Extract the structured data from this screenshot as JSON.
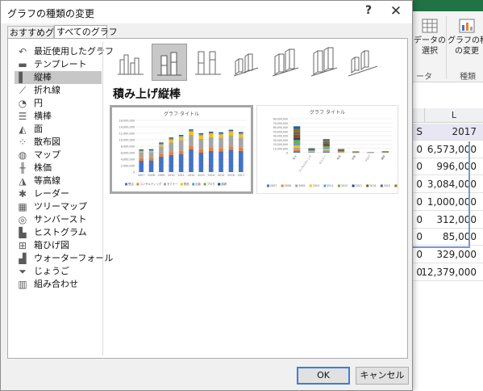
{
  "dialog": {
    "title": "グラフの種類の変更",
    "help": "?",
    "close": "✕"
  },
  "tabs": [
    {
      "label": "おすすめグラフ"
    },
    {
      "label": "すべてのグラフ"
    }
  ],
  "sidebar": {
    "items": [
      {
        "label": "最近使用したグラフ",
        "icon": "undo-icon",
        "glyph": "↶"
      },
      {
        "label": "テンプレート",
        "icon": "folder-icon",
        "glyph": "▬"
      },
      {
        "label": "縦棒",
        "icon": "column-chart-icon",
        "glyph": "▌"
      },
      {
        "label": "折れ線",
        "icon": "line-chart-icon",
        "glyph": "⟋"
      },
      {
        "label": "円",
        "icon": "pie-chart-icon",
        "glyph": "◔"
      },
      {
        "label": "横棒",
        "icon": "bar-chart-icon",
        "glyph": "☰"
      },
      {
        "label": "面",
        "icon": "area-chart-icon",
        "glyph": "◭"
      },
      {
        "label": "散布図",
        "icon": "scatter-chart-icon",
        "glyph": "⁘"
      },
      {
        "label": "マップ",
        "icon": "map-chart-icon",
        "glyph": "◍"
      },
      {
        "label": "株価",
        "icon": "stock-chart-icon",
        "glyph": "╫"
      },
      {
        "label": "等高線",
        "icon": "surface-chart-icon",
        "glyph": "◮"
      },
      {
        "label": "レーダー",
        "icon": "radar-chart-icon",
        "glyph": "✱"
      },
      {
        "label": "ツリーマップ",
        "icon": "treemap-chart-icon",
        "glyph": "▦"
      },
      {
        "label": "サンバースト",
        "icon": "sunburst-chart-icon",
        "glyph": "◎"
      },
      {
        "label": "ヒストグラム",
        "icon": "histogram-chart-icon",
        "glyph": "▙"
      },
      {
        "label": "箱ひげ図",
        "icon": "box-whisker-chart-icon",
        "glyph": "⊞"
      },
      {
        "label": "ウォーターフォール",
        "icon": "waterfall-chart-icon",
        "glyph": "▟"
      },
      {
        "label": "じょうご",
        "icon": "funnel-chart-icon",
        "glyph": "⏷"
      },
      {
        "label": "組み合わせ",
        "icon": "combo-chart-icon",
        "glyph": "▥"
      }
    ],
    "selected_index": 2
  },
  "chart_heading": "積み上げ縦棒",
  "previews": [
    {
      "title": "グラフ タイトル"
    },
    {
      "title": "グラフ タイトル"
    }
  ],
  "buttons": {
    "ok": "OK",
    "cancel": "キャンセル"
  },
  "excel": {
    "ribbon": {
      "data_select": "データの\n選択",
      "change_type": "グラフの種類\nの変更",
      "group_data": "ータ",
      "group_type": "種類"
    },
    "column_header": "L",
    "rows": [
      {
        "left": "S",
        "value": "2017"
      },
      {
        "left": "0",
        "value": "6,573,000"
      },
      {
        "left": "0",
        "value": "996,000"
      },
      {
        "left": "0",
        "value": "3,084,000"
      },
      {
        "left": "0",
        "value": "1,000,000"
      },
      {
        "left": "0",
        "value": "312,000"
      },
      {
        "left": "0",
        "value": "85,000"
      },
      {
        "left": "0",
        "value": "329,000"
      },
      {
        "left": "0",
        "value": "12,379,000"
      }
    ],
    "accent": "#217346"
  },
  "chart_data": [
    {
      "type": "bar",
      "stacked": true,
      "title": "グラフ タイトル",
      "categories": [
        "2007",
        "2008",
        "2009",
        "2010",
        "2011",
        "2012",
        "2013",
        "2014",
        "2015",
        "2016",
        "2017"
      ],
      "ylim": [
        0,
        16000000
      ],
      "yticks": [
        "0",
        "2,000,000",
        "4,000,000",
        "6,000,000",
        "8,000,000",
        "10,000,000",
        "12,000,000",
        "14,000,000",
        "16,000,000"
      ],
      "legend_position": "bottom",
      "series": [
        {
          "name": "受注",
          "color": "#4472c4",
          "values": [
            3500000,
            3600000,
            4800000,
            5300000,
            5600000,
            7000000,
            6000000,
            6500000,
            6400000,
            6900000,
            6573000
          ]
        },
        {
          "name": "コンサルティング",
          "color": "#ed7d31",
          "values": [
            800000,
            800000,
            900000,
            900000,
            1000000,
            1000000,
            1100000,
            1000000,
            1000000,
            1000000,
            996000
          ]
        },
        {
          "name": "セミナー",
          "color": "#a5a5a5",
          "values": [
            1800000,
            1800000,
            2200000,
            3000000,
            3300000,
            3500000,
            3200000,
            3300000,
            3300000,
            3500000,
            3084000
          ]
        },
        {
          "name": "物品",
          "color": "#ffc000",
          "values": [
            300000,
            300000,
            600000,
            800000,
            900000,
            1000000,
            1000000,
            1000000,
            900000,
            1000000,
            1000000
          ]
        },
        {
          "name": "出版",
          "color": "#5b9bd5",
          "values": [
            200000,
            200000,
            250000,
            300000,
            300000,
            300000,
            300000,
            300000,
            300000,
            300000,
            312000
          ]
        },
        {
          "name": "ブログ",
          "color": "#70ad47",
          "values": [
            80000,
            80000,
            90000,
            90000,
            90000,
            90000,
            90000,
            90000,
            90000,
            90000,
            85000
          ]
        },
        {
          "name": "講師",
          "color": "#264478",
          "values": [
            300000,
            300000,
            300000,
            300000,
            300000,
            300000,
            300000,
            300000,
            300000,
            300000,
            329000
          ]
        }
      ]
    },
    {
      "type": "bar",
      "stacked": true,
      "title": "グラフ タイトル",
      "categories": [
        "受注",
        "コンサルティング",
        "セミナー",
        "物品",
        "出版",
        "ブログ",
        "講師"
      ],
      "ylim": [
        0,
        80000000
      ],
      "yticks": [
        "0",
        "10,000,000",
        "20,000,000",
        "30,000,000",
        "40,000,000",
        "50,000,000",
        "60,000,000",
        "70,000,000",
        "80,000,000"
      ],
      "legend_position": "bottom",
      "series": [
        {
          "name": "2007",
          "color": "#4472c4",
          "values": [
            3500000,
            800000,
            1800000,
            300000,
            200000,
            80000,
            300000
          ]
        },
        {
          "name": "2008",
          "color": "#ed7d31",
          "values": [
            3600000,
            800000,
            1800000,
            300000,
            200000,
            80000,
            300000
          ]
        },
        {
          "name": "2009",
          "color": "#a5a5a5",
          "values": [
            4800000,
            900000,
            2200000,
            600000,
            250000,
            90000,
            300000
          ]
        },
        {
          "name": "2010",
          "color": "#ffc000",
          "values": [
            5300000,
            900000,
            3000000,
            800000,
            300000,
            90000,
            300000
          ]
        },
        {
          "name": "2011",
          "color": "#5b9bd5",
          "values": [
            5600000,
            1000000,
            3300000,
            900000,
            300000,
            90000,
            300000
          ]
        },
        {
          "name": "2012",
          "color": "#70ad47",
          "values": [
            7000000,
            1000000,
            3500000,
            1000000,
            300000,
            90000,
            300000
          ]
        },
        {
          "name": "2013",
          "color": "#264478",
          "values": [
            6000000,
            1100000,
            3200000,
            1000000,
            300000,
            90000,
            300000
          ]
        },
        {
          "name": "2014",
          "color": "#9e480e",
          "values": [
            6500000,
            1000000,
            3300000,
            1000000,
            300000,
            90000,
            300000
          ]
        },
        {
          "name": "2015",
          "color": "#636363",
          "values": [
            6400000,
            1000000,
            3300000,
            900000,
            300000,
            90000,
            300000
          ]
        },
        {
          "name": "2016",
          "color": "#997300",
          "values": [
            6900000,
            1000000,
            3500000,
            1000000,
            300000,
            90000,
            300000
          ]
        },
        {
          "name": "2017",
          "color": "#255e91",
          "values": [
            6573000,
            996000,
            3084000,
            1000000,
            312000,
            85000,
            329000
          ]
        }
      ]
    }
  ]
}
